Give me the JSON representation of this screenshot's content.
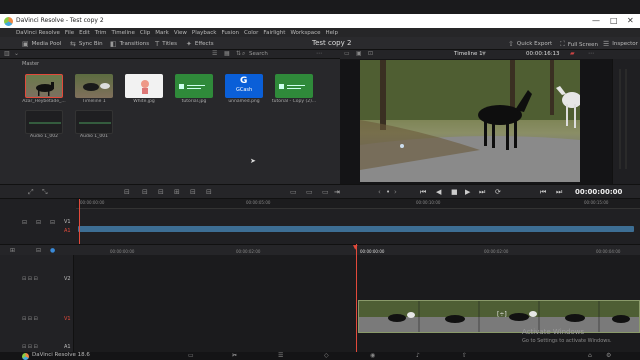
{
  "window": {
    "title": "DaVinci Resolve - Test copy 2",
    "minimize": "—",
    "maximize": "□",
    "close": "✕"
  },
  "menu": [
    "DaVinci Resolve",
    "File",
    "Edit",
    "Trim",
    "Timeline",
    "Clip",
    "Mark",
    "View",
    "Playback",
    "Fusion",
    "Color",
    "Fairlight",
    "Workspace",
    "Help"
  ],
  "toolbar": {
    "media_pool": "Media Pool",
    "sync_bin": "Sync Bin",
    "transitions": "Transitions",
    "titles": "Titles",
    "effects": "Effects",
    "project_title": "Test copy 2",
    "quick_export": "Quick Export",
    "full_screen": "Full Screen",
    "inspector": "Inspector"
  },
  "media_pool": {
    "search": "Search",
    "bin": "Master",
    "clips": [
      {
        "label": "Azar_Heybetade_..."
      },
      {
        "label": "Timeline 1"
      },
      {
        "label": "White.jpg"
      },
      {
        "label": "tutorial.jpg"
      },
      {
        "label": "unnamed.png",
        "inner_title": "G",
        "inner_sub": "GCash"
      },
      {
        "label": "tutorial - Copy (2)..."
      },
      {
        "label": "Audio 1_002"
      },
      {
        "label": "Audio 1_001"
      }
    ]
  },
  "viewer": {
    "timeline_name": "Timeline 1",
    "timecode_top": "00:00:16:13",
    "zoom_indicator": "▼"
  },
  "transport": {
    "timecode": "00:00:00:00"
  },
  "upper_ruler": [
    "00:00:00:00",
    "00:00:05:00",
    "00:00:10:00",
    "00:00:15:00"
  ],
  "lower_ruler": [
    "00:00:00:00",
    "00:00:02:00",
    "00:00:04:00",
    "00:00:02:00",
    "00:00:04:00"
  ],
  "tracks": {
    "upper": [
      "V1",
      "A1"
    ],
    "lower": [
      "V2",
      "V1",
      "A1"
    ]
  },
  "watermark": {
    "line1": "Activate Windows",
    "line2": "Go to Settings to activate Windows."
  },
  "bottom": {
    "app": "DaVinci Resolve 18.6"
  },
  "colors": {
    "accent_red": "#e24a3b",
    "clip_green": "#2f8a3a",
    "audio_blue": "#3d6e94",
    "gcash_blue": "#0a5fd8"
  }
}
